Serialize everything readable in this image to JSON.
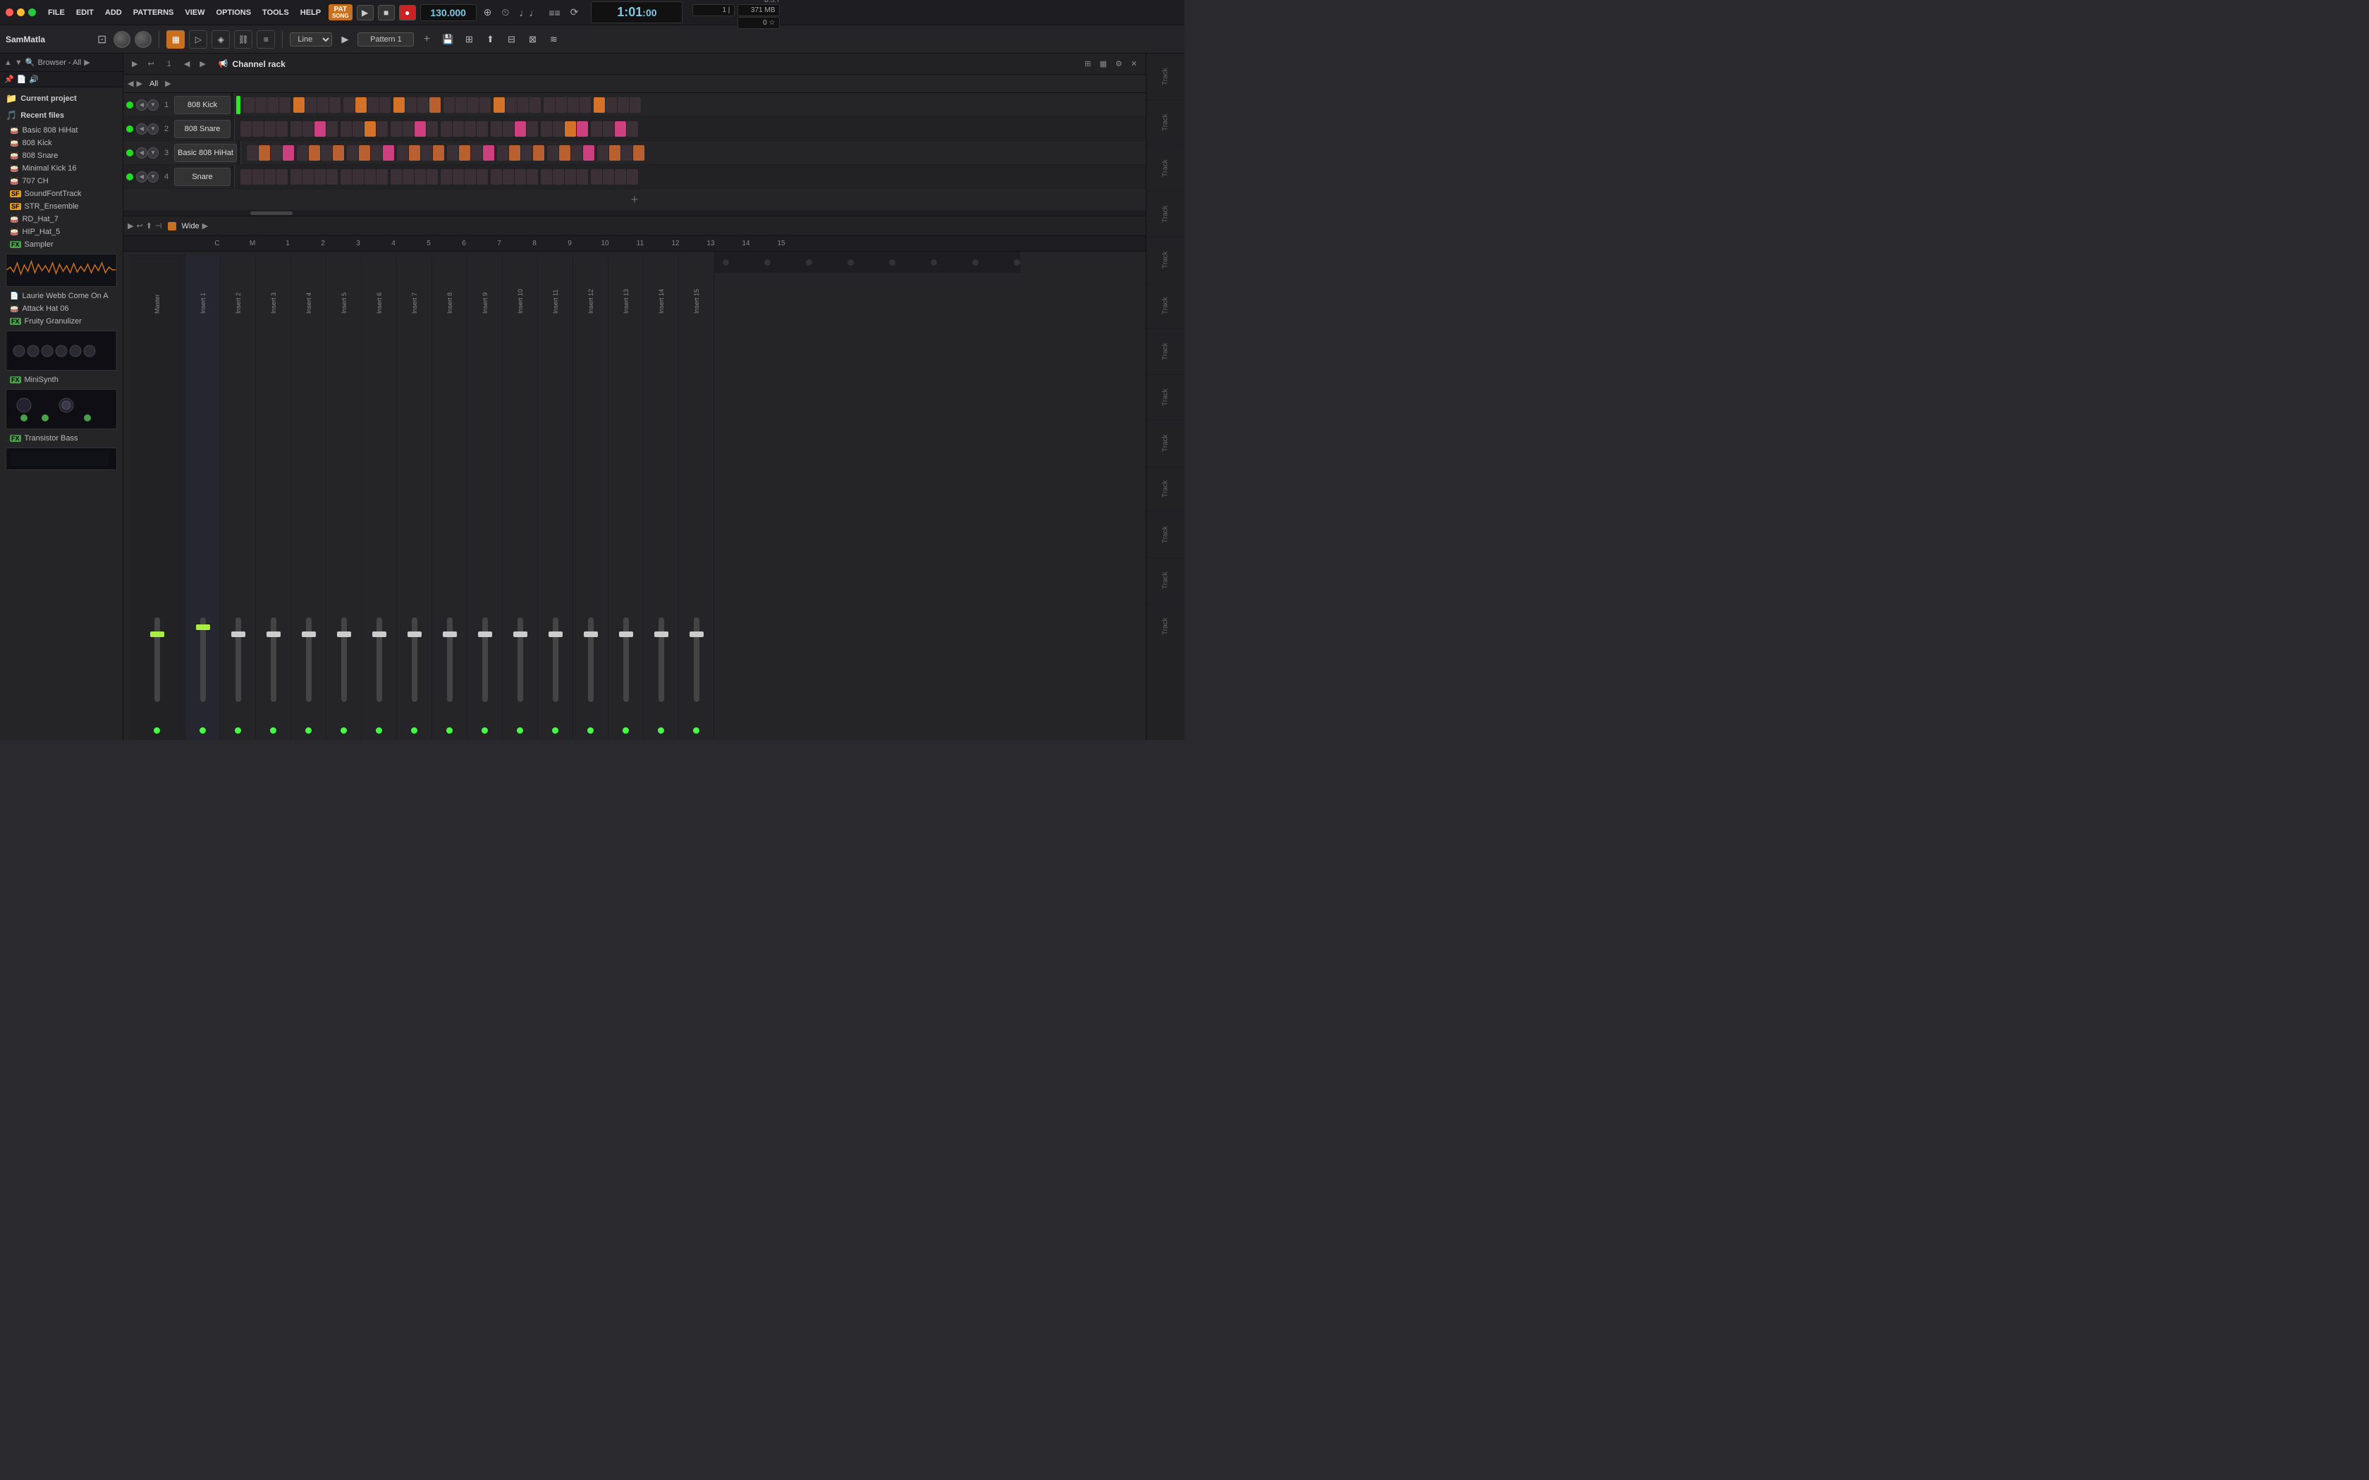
{
  "titlebar": {
    "pat_label": "PAT",
    "song_label": "SONG",
    "tempo": "130.000",
    "time": "1:01",
    "time_sub": ":00",
    "bst": "B:S:T",
    "info1": "1 |",
    "info2": "371 MB",
    "info3": "0 ☆",
    "menu": [
      "FILE",
      "EDIT",
      "ADD",
      "PATTERNS",
      "VIEW",
      "OPTIONS",
      "TOOLS",
      "HELP"
    ]
  },
  "toolbar2": {
    "project_name": "SamMatla",
    "line_label": "Line",
    "pattern_label": "Pattern 1"
  },
  "sidebar": {
    "browser_label": "Browser - All",
    "current_project": "Current project",
    "recent_files": "Recent files",
    "items": [
      {
        "label": "Basic 808 HiHat",
        "type": "drum"
      },
      {
        "label": "808 Kick",
        "type": "drum"
      },
      {
        "label": "808 Snare",
        "type": "drum"
      },
      {
        "label": "Minimal Kick 16",
        "type": "drum"
      },
      {
        "label": "707 CH",
        "type": "drum"
      },
      {
        "label": "SoundFontTrack",
        "type": "sf"
      },
      {
        "label": "STR_Ensemble",
        "type": "sf"
      },
      {
        "label": "RD_Hat_7",
        "type": "drum"
      },
      {
        "label": "HIP_Hat_5",
        "type": "drum"
      },
      {
        "label": "Sampler",
        "type": "fx"
      },
      {
        "label": "Laurie Webb Come On A",
        "type": "fx"
      },
      {
        "label": "Attack Hat 06",
        "type": "drum"
      },
      {
        "label": "Fruity Granulizer",
        "type": "fx"
      },
      {
        "label": "MiniSynth",
        "type": "fx"
      },
      {
        "label": "Transistor Bass",
        "type": "fx"
      }
    ]
  },
  "channel_rack": {
    "title": "Channel rack",
    "channels": [
      {
        "num": "1",
        "name": "808 Kick",
        "led": true
      },
      {
        "num": "2",
        "name": "808 Snare",
        "led": true
      },
      {
        "num": "3",
        "name": "Basic 808 HiHat",
        "led": true
      },
      {
        "num": "4",
        "name": "Snare",
        "led": true
      }
    ]
  },
  "lower": {
    "wide_label": "Wide",
    "mixer_channels": [
      "Master",
      "Insert 1",
      "Insert 2",
      "Insert 3",
      "Insert 4",
      "Insert 5",
      "Insert 6",
      "Insert 7",
      "Insert 8",
      "Insert 9",
      "Insert 10",
      "Insert 11",
      "Insert 12",
      "Insert 13",
      "Insert 14",
      "Insert 15"
    ],
    "mixer_nums": [
      "C",
      "M",
      "1",
      "2",
      "3",
      "4",
      "5",
      "6",
      "7",
      "8",
      "9",
      "10",
      "11",
      "12",
      "13",
      "14",
      "15"
    ]
  },
  "right_sidebar": {
    "tracks": [
      "Track",
      "Track",
      "Track",
      "Track",
      "Track",
      "Track",
      "Track",
      "Track",
      "Track",
      "Track",
      "Track",
      "Track",
      "Track"
    ]
  }
}
